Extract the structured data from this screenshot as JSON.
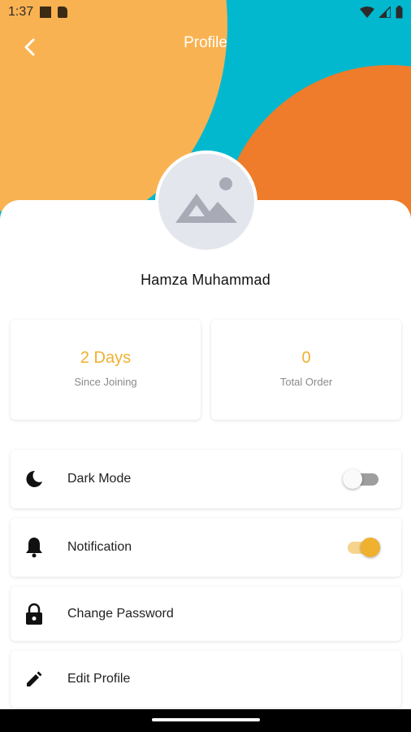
{
  "status_bar": {
    "time": "1:37"
  },
  "app_bar": {
    "title": "Profile",
    "back_icon": "chevron-left-icon"
  },
  "colors": {
    "header_cyan": "#02B8CF",
    "header_yellow": "#F9B251",
    "header_orange": "#EE7C2A",
    "accent": "#F0B030"
  },
  "profile": {
    "name": "Hamza Muhammad",
    "avatar_icon": "image-placeholder-icon"
  },
  "stats": [
    {
      "value": "2 Days",
      "label": "Since Joining"
    },
    {
      "value": "0",
      "label": "Total Order"
    }
  ],
  "settings": [
    {
      "icon": "moon-icon",
      "label": "Dark Mode",
      "toggle": false
    },
    {
      "icon": "bell-icon",
      "label": "Notification",
      "toggle": true
    },
    {
      "icon": "lock-icon",
      "label": "Change Password"
    },
    {
      "icon": "pencil-icon",
      "label": "Edit Profile"
    }
  ]
}
